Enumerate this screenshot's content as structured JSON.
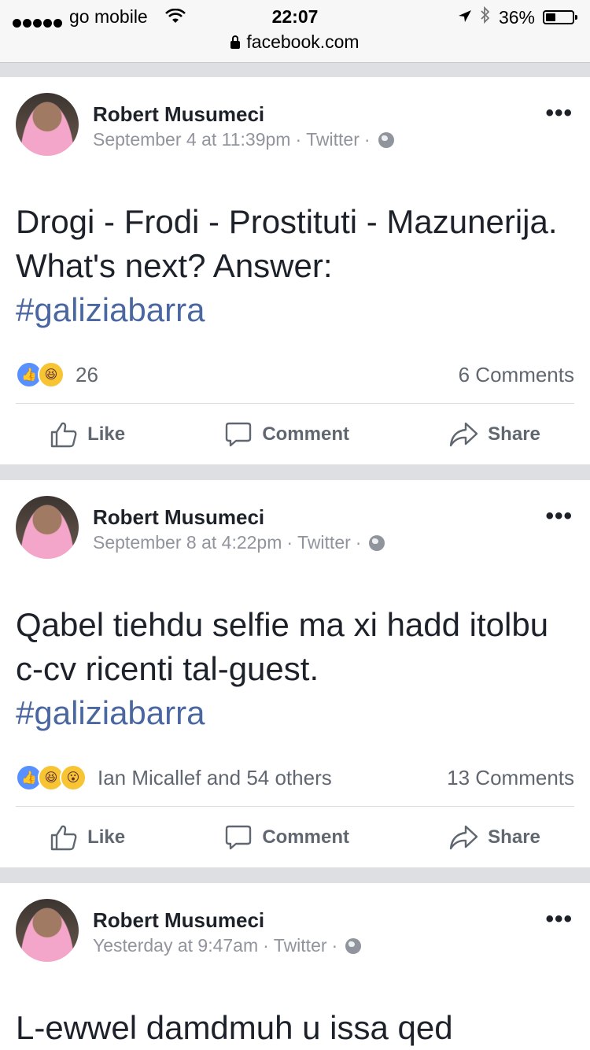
{
  "status_bar": {
    "carrier": "go mobile",
    "time": "22:07",
    "battery": "36%",
    "battery_level": 0.36,
    "url": "facebook.com"
  },
  "posts": [
    {
      "author": "Robert Musumeci",
      "time": "September 4 at 11:39pm",
      "source": "Twitter",
      "text": "Drogi - Frodi - Prostituti - Mazunerija. What's next? Answer:",
      "hashtag": "#galiziabarra",
      "reaction_icons": [
        "like",
        "haha"
      ],
      "reactions": "26",
      "comments": "6 Comments",
      "actions": {
        "like": "Like",
        "comment": "Comment",
        "share": "Share"
      }
    },
    {
      "author": "Robert Musumeci",
      "time": "September 8 at 4:22pm",
      "source": "Twitter",
      "text": "Qabel tiehdu selfie ma xi hadd itolbu c-cv ricenti tal-guest.",
      "hashtag": "#galiziabarra",
      "reaction_icons": [
        "like",
        "haha",
        "wow"
      ],
      "reactions": "Ian Micallef and 54 others",
      "comments": "13 Comments",
      "actions": {
        "like": "Like",
        "comment": "Comment",
        "share": "Share"
      }
    },
    {
      "author": "Robert Musumeci",
      "time": "Yesterday at 9:47am",
      "source": "Twitter",
      "text": "L-ewwel damdmuh u issa qed"
    }
  ]
}
